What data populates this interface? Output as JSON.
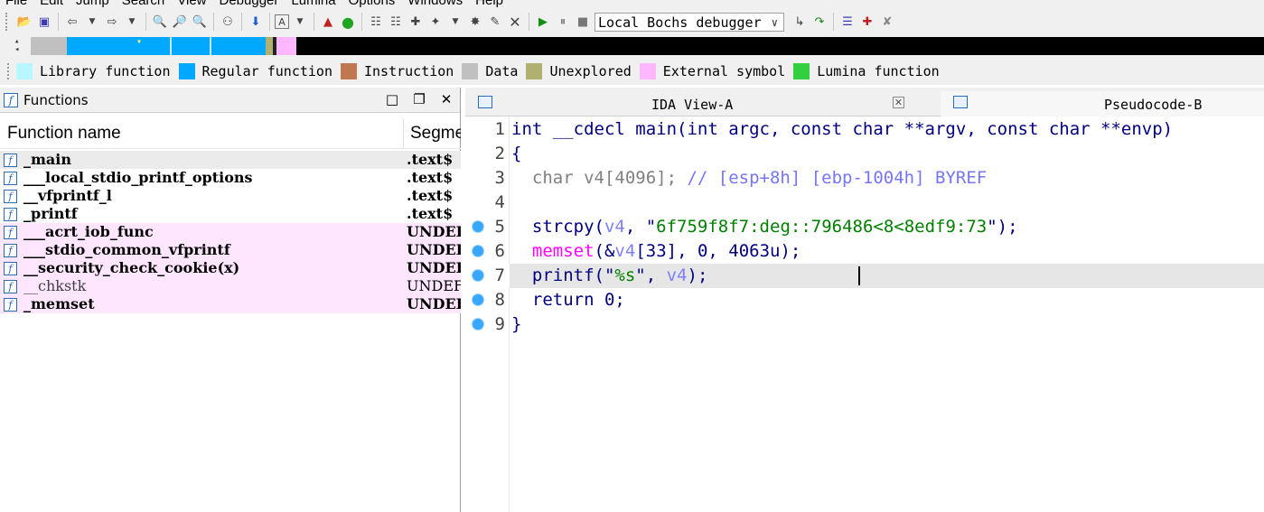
{
  "menu": [
    "File",
    "Edit",
    "Jump",
    "Search",
    "View",
    "Debugger",
    "Lumina",
    "Options",
    "Windows",
    "Help"
  ],
  "toolbar": {
    "debugger_select": "Local Bochs debugger"
  },
  "legend": [
    {
      "label": "Library function",
      "color": "#b8f7ff"
    },
    {
      "label": "Regular function",
      "color": "#00a8ff"
    },
    {
      "label": "Instruction",
      "color": "#c07850"
    },
    {
      "label": "Data",
      "color": "#c0c0c0"
    },
    {
      "label": "Unexplored",
      "color": "#b0b070"
    },
    {
      "label": "External symbol",
      "color": "#ffb8ff"
    },
    {
      "label": "Lumina function",
      "color": "#30d040"
    }
  ],
  "functions_panel": {
    "title": "Functions",
    "columns": {
      "name": "Function name",
      "segment": "Segment"
    },
    "rows": [
      {
        "name": "_main",
        "segment": ".text$",
        "bg": "#ebebeb"
      },
      {
        "name": "___local_stdio_printf_options",
        "segment": ".text$",
        "bg": "#ffffff"
      },
      {
        "name": "__vfprintf_l",
        "segment": ".text$",
        "bg": "#ffffff"
      },
      {
        "name": "_printf",
        "segment": ".text$",
        "bg": "#ffffff"
      },
      {
        "name": "___acrt_iob_func",
        "segment": "UNDEF",
        "bg": "#ffe6ff"
      },
      {
        "name": "___stdio_common_vfprintf",
        "segment": "UNDEF",
        "bg": "#ffe6ff"
      },
      {
        "name": "__security_check_cookie(x)",
        "segment": "UNDEF",
        "bg": "#ffe6ff"
      },
      {
        "name": "__chkstk",
        "segment": "UNDEF",
        "bg": "#ffe6ff"
      },
      {
        "name": "_memset",
        "segment": "UNDEF",
        "bg": "#ffe6ff"
      }
    ]
  },
  "tabs": [
    {
      "label": "IDA View-A"
    },
    {
      "label": "Pseudocode-B"
    }
  ],
  "code": {
    "line_numbers": [
      "1",
      "2",
      "3",
      "4",
      "5",
      "6",
      "7",
      "8",
      "9"
    ],
    "l1": "int __cdecl main(int argc, const char **argv, const char **envp)",
    "l2": "{",
    "l3a": "  char v4[4096]; ",
    "l3b": "// [esp+8h] [ebp-1004h] BYREF",
    "l5a": "  strcpy(",
    "l5b": "v4",
    "l5c": ", \"",
    "l5d": "6f759f8f7:deg::796486<8<8edf9:73",
    "l5e": "\");",
    "l6a": "  ",
    "l6b": "memset",
    "l6c": "(&",
    "l6d": "v4",
    "l6e": "[33], 0, 4063u);",
    "l7a": "  printf(\"",
    "l7b": "%s",
    "l7c": "\", ",
    "l7d": "v4",
    "l7e": ");",
    "l8": "  return 0;",
    "l9": "}"
  }
}
